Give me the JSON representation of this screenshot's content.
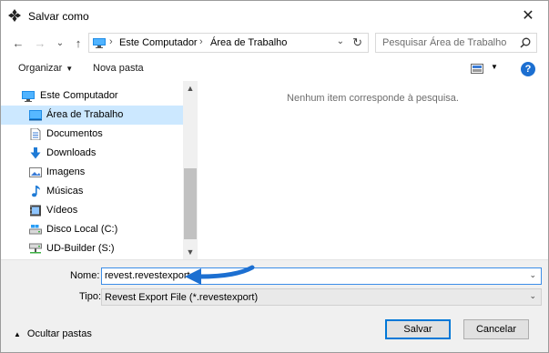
{
  "window": {
    "title": "Salvar como",
    "close": "✕"
  },
  "nav": {
    "back": "←",
    "forward": "→",
    "recent": "⌄",
    "up": "↑",
    "breadcrumb": [
      "Este Computador",
      "Área de Trabalho"
    ],
    "separator": "›",
    "dropdown": "⌄",
    "refresh": "↻",
    "search_placeholder": "Pesquisar Área de Trabalho"
  },
  "toolbar": {
    "organize": "Organizar",
    "organize_caret": "▼",
    "new_folder": "Nova pasta",
    "view_caret": "▼",
    "help": "?"
  },
  "tree": {
    "items": [
      {
        "label": "Este Computador",
        "icon": "computer-icon"
      },
      {
        "label": "Área de Trabalho",
        "icon": "desktop-icon",
        "selected": true
      },
      {
        "label": "Documentos",
        "icon": "documents-icon"
      },
      {
        "label": "Downloads",
        "icon": "downloads-icon"
      },
      {
        "label": "Imagens",
        "icon": "pictures-icon"
      },
      {
        "label": "Músicas",
        "icon": "music-icon"
      },
      {
        "label": "Vídeos",
        "icon": "videos-icon"
      },
      {
        "label": "Disco Local (C:)",
        "icon": "local-disk-icon"
      },
      {
        "label": "UD-Builder (S:)",
        "icon": "network-drive-icon"
      }
    ],
    "scroll_up": "▲",
    "scroll_down": "▼"
  },
  "content": {
    "empty_message": "Nenhum item corresponde à pesquisa."
  },
  "form": {
    "name_label": "Nome:",
    "name_value": "revest.revestexport",
    "type_label": "Tipo:",
    "type_value": "Revest Export File (*.revestexport)",
    "caret": "⌄"
  },
  "footer": {
    "hide_folders": "Ocultar pastas",
    "hide_caret": "▲",
    "save": "Salvar",
    "cancel": "Cancelar"
  },
  "colors": {
    "accent": "#0078d7",
    "selection": "#cce8ff",
    "annotation_arrow": "#1c6fd1"
  }
}
